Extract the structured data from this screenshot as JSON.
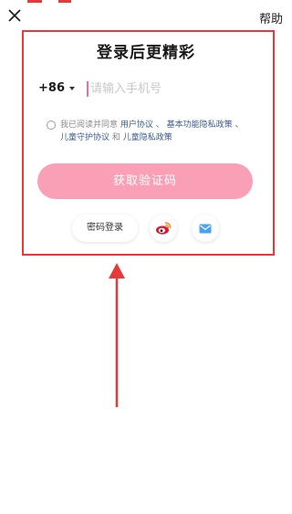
{
  "header": {
    "close_icon": "close-icon",
    "help_label": "帮助"
  },
  "login": {
    "title": "登录后更精彩",
    "country_code": "+86",
    "phone_placeholder": "请输入手机号",
    "agreement": {
      "prefix": "我已阅读并同意",
      "user_agreement": "用户协议",
      "sep1": "、",
      "privacy_policy": "基本功能隐私政策",
      "sep2": "、",
      "child_agreement": "儿童守护协议",
      "and": " 和 ",
      "child_privacy": "儿童隐私政策"
    },
    "get_code_label": "获取验证码",
    "password_login_label": "密码登录",
    "weibo_icon": "weibo-icon",
    "mail_icon": "mail-icon"
  },
  "colors": {
    "annotation_red": "#e8393a",
    "accent_pink": "#fb6a8c",
    "button_pink_disabled": "#f9a0b6",
    "link_blue": "#3b5a8c"
  }
}
